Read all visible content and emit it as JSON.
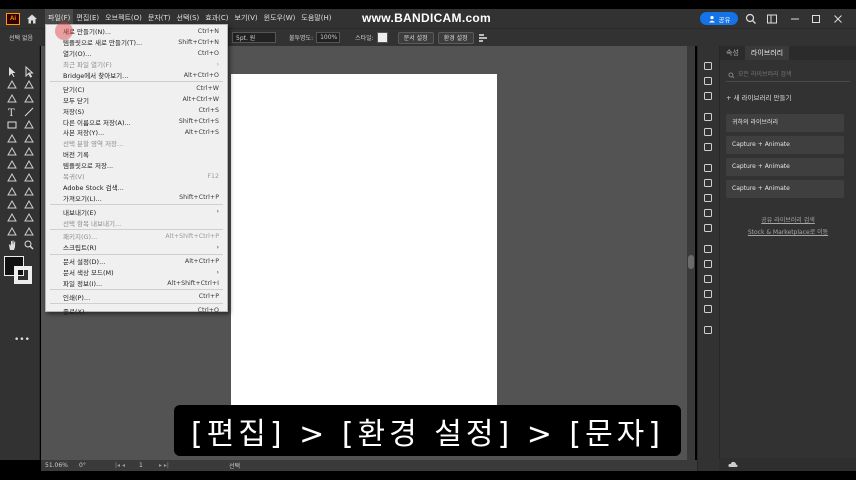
{
  "app": {
    "logo": "Ai",
    "watermark": "www.BANDICAM.com",
    "share_label": "공유"
  },
  "menubar": {
    "items": [
      "파일(F)",
      "편집(E)",
      "오브젝트(O)",
      "문자(T)",
      "선택(S)",
      "효과(C)",
      "보기(V)",
      "윈도우(W)",
      "도움말(H)"
    ]
  },
  "controlbar": {
    "selection_label": "선택 없음",
    "stroke_value": "5pt. 원",
    "opacity_label": "불투명도:",
    "opacity_value": "100%",
    "style_label": "스타일:",
    "doc_setup_button": "문서 설정",
    "prefs_button": "환경 설정"
  },
  "file_menu": {
    "rows": [
      {
        "label": "새로 만들기(N)...",
        "shortcut": "Ctrl+N",
        "disabled": false
      },
      {
        "label": "템플릿으로 새로 만들기(T)...",
        "shortcut": "Shift+Ctrl+N",
        "disabled": false
      },
      {
        "label": "열기(O)...",
        "shortcut": "Ctrl+O",
        "disabled": false
      },
      {
        "label": "최근 파일 열기(F)",
        "shortcut": "›",
        "disabled": true
      },
      {
        "label": "Bridge에서 찾아보기...",
        "shortcut": "Alt+Ctrl+O",
        "disabled": false
      },
      {
        "sep": true
      },
      {
        "label": "닫기(C)",
        "shortcut": "Ctrl+W",
        "disabled": false
      },
      {
        "label": "모두 닫기",
        "shortcut": "Alt+Ctrl+W",
        "disabled": false
      },
      {
        "label": "저장(S)",
        "shortcut": "Ctrl+S",
        "disabled": false
      },
      {
        "label": "다른 이름으로 저장(A)...",
        "shortcut": "Shift+Ctrl+S",
        "disabled": false
      },
      {
        "label": "사본 저장(Y)...",
        "shortcut": "Alt+Ctrl+S",
        "disabled": false
      },
      {
        "label": "선택 분할 영역 저장...",
        "shortcut": "",
        "disabled": true
      },
      {
        "label": "버전 기록",
        "shortcut": "",
        "disabled": false
      },
      {
        "label": "템플릿으로 저장...",
        "shortcut": "",
        "disabled": false
      },
      {
        "label": "복귀(V)",
        "shortcut": "F12",
        "disabled": true
      },
      {
        "label": "Adobe Stock 검색...",
        "shortcut": "",
        "disabled": false
      },
      {
        "label": "가져오기(L)...",
        "shortcut": "Shift+Ctrl+P",
        "disabled": false
      },
      {
        "sep": true
      },
      {
        "label": "내보내기(E)",
        "shortcut": "›",
        "disabled": false
      },
      {
        "label": "선택 항목 내보내기...",
        "shortcut": "",
        "disabled": true
      },
      {
        "sep": true
      },
      {
        "label": "패키지(G)...",
        "shortcut": "Alt+Shift+Ctrl+P",
        "disabled": true
      },
      {
        "label": "스크립트(R)",
        "shortcut": "›",
        "disabled": false
      },
      {
        "sep": true
      },
      {
        "label": "문서 설정(D)...",
        "shortcut": "Alt+Ctrl+P",
        "disabled": false
      },
      {
        "label": "문서 색상 모드(M)",
        "shortcut": "›",
        "disabled": false
      },
      {
        "label": "파일 정보(I)...",
        "shortcut": "Alt+Shift+Ctrl+I",
        "disabled": false
      },
      {
        "sep": true
      },
      {
        "label": "인쇄(P)...",
        "shortcut": "Ctrl+P",
        "disabled": false
      },
      {
        "sep": true
      },
      {
        "label": "종료(X)",
        "shortcut": "Ctrl+Q",
        "disabled": false
      }
    ]
  },
  "panel": {
    "tabs": [
      "속성",
      "라이브러리"
    ],
    "search_placeholder": "모든 라이브러리 검색",
    "new_library": "+ 새 라이브러리 만들기",
    "cards": [
      "귀하의 라이브러리",
      "Capture + Animate",
      "Capture + Animate",
      "Capture + Animate"
    ],
    "links": [
      "공유 라이브러리 검색",
      "Stock & Marketplace로 이동"
    ]
  },
  "status": {
    "zoom": "51.06%",
    "rotation": "0°",
    "artboard_num": "1",
    "mode": "선택"
  },
  "subtitle": "[편집] > [환경 설정] > [문자]",
  "colors": {
    "accent": "#1473e6",
    "chrome": "#323232",
    "canvas": "#535353"
  }
}
